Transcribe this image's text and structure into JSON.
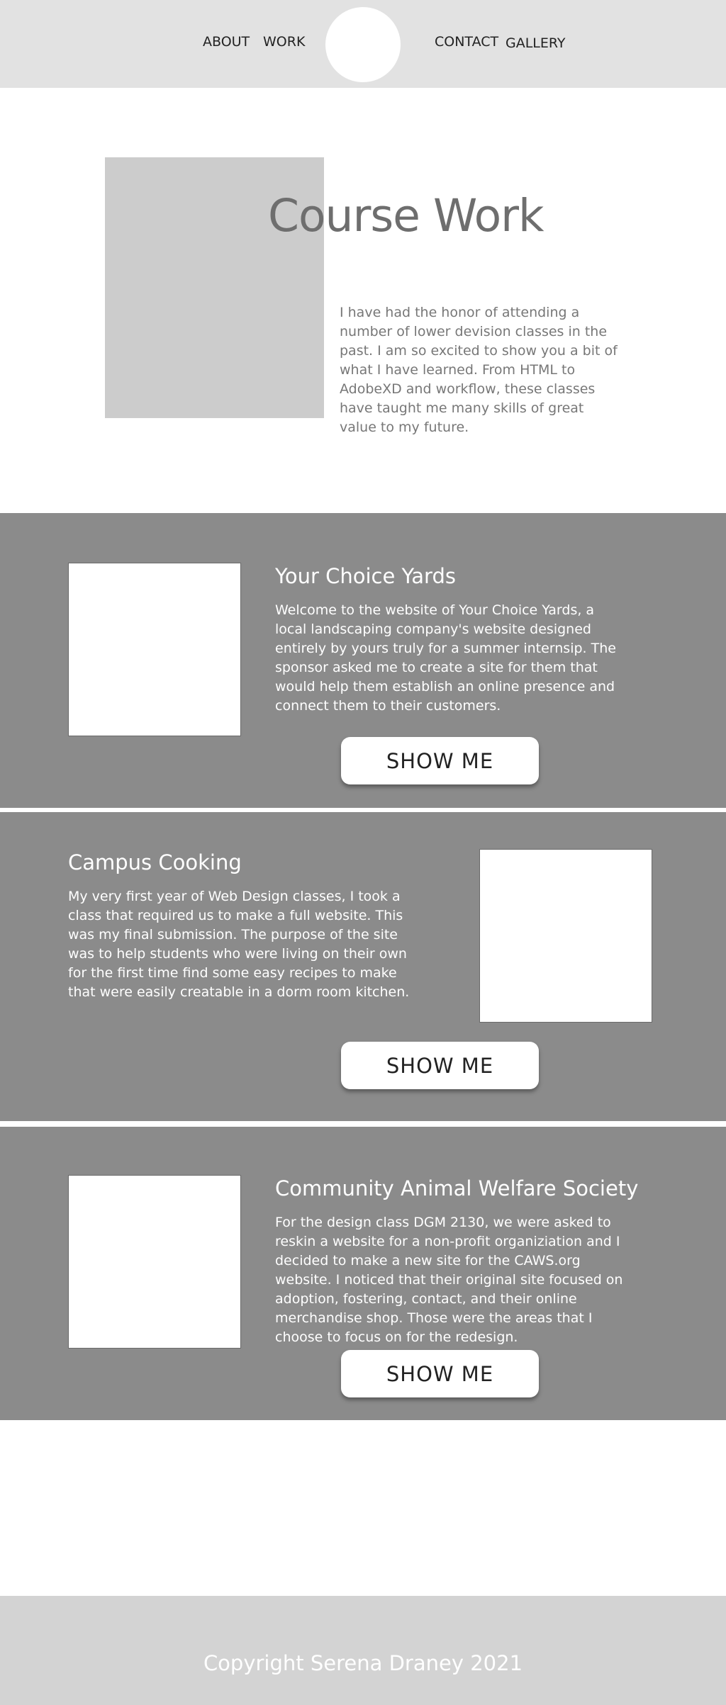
{
  "nav": {
    "about": "ABOUT",
    "work": "WORK",
    "contact": "CONTACT",
    "gallery": "GALLERY"
  },
  "intro": {
    "title": "Course Work",
    "text": "I have had the honor of attending a number of lower devision classes in the past. I am so excited to show you a bit of what I have learned. From HTML to AdobeXD and workflow, these classes have taught me many skills of great value to my future."
  },
  "projects": [
    {
      "title": "Your Choice Yards",
      "text": "Welcome to the website of Your Choice Yards, a local landscaping company's website designed entirely by yours truly for a summer internsip. The sponsor asked me to create a site for them that would help them establish an online presence and connect them to their customers.",
      "button": "SHOW ME"
    },
    {
      "title": "Campus Cooking",
      "text": "My very first year of Web Design classes, I took a class that required us to make a full website. This was my final submission. The purpose of the site was to help students who were living on their own for the first time find some easy recipes to make that were easily creatable in a dorm room kitchen.",
      "button": "SHOW ME"
    },
    {
      "title": "Community Animal Welfare Society",
      "text": "For the design class DGM 2130, we were asked to reskin a website for a non-profit organiziation and I decided to make a new site for the CAWS.org website. I noticed that their original site focused on adoption, fostering, contact, and their online merchandise shop. Those were the areas that I choose to focus on for the redesign.",
      "button": "SHOW ME"
    }
  ],
  "footer": {
    "copyright": "Copyright Serena Draney 2021"
  },
  "colors": {
    "header_bg": "#e2e2e2",
    "section_bg": "#8b8b8b",
    "footer_bg": "#d3d3d3",
    "placeholder": "#cccccc"
  }
}
